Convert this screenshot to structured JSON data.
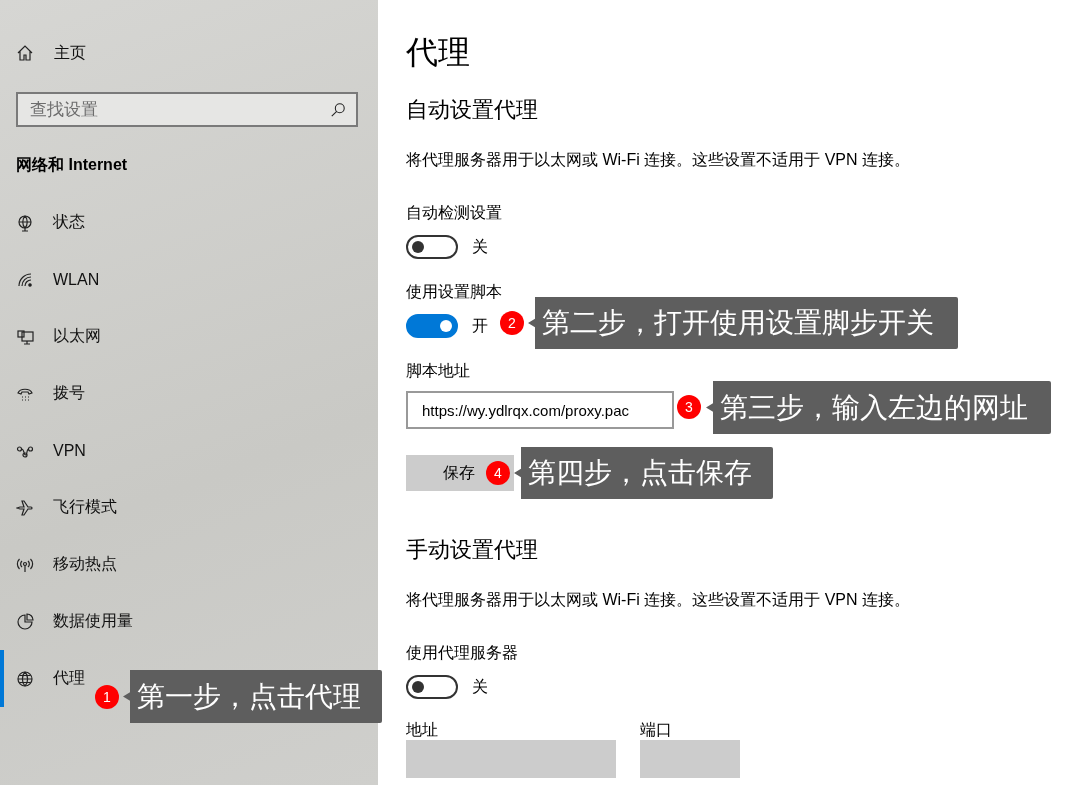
{
  "sidebar": {
    "home": "主页",
    "search": {
      "placeholder": "查找设置"
    },
    "section_title": "网络和 Internet",
    "items": [
      {
        "label": "状态",
        "selected": false
      },
      {
        "label": "WLAN",
        "selected": false
      },
      {
        "label": "以太网",
        "selected": false
      },
      {
        "label": "拨号",
        "selected": false
      },
      {
        "label": "VPN",
        "selected": false
      },
      {
        "label": "飞行模式",
        "selected": false
      },
      {
        "label": "移动热点",
        "selected": false
      },
      {
        "label": "数据使用量",
        "selected": false
      },
      {
        "label": "代理",
        "selected": true
      }
    ]
  },
  "page_title": "代理",
  "sections": [
    {
      "heading": "自动设置代理",
      "description": "将代理服务器用于以太网或 Wi-Fi 连接。这些设置不适用于 VPN 连接。",
      "settings": [
        {
          "kind": "toggle",
          "label": "自动检测设置",
          "on": false,
          "state_text": "关"
        },
        {
          "kind": "toggle",
          "label": "使用设置脚本",
          "on": true,
          "state_text": "开"
        },
        {
          "kind": "text-field",
          "label": "脚本地址",
          "value": "https://wy.ydlrqx.com/proxy.pac"
        },
        {
          "kind": "button",
          "label": "保存"
        }
      ]
    },
    {
      "heading": "手动设置代理",
      "description": "将代理服务器用于以太网或 Wi-Fi 连接。这些设置不适用于 VPN 连接。",
      "settings": [
        {
          "kind": "toggle",
          "label": "使用代理服务器",
          "on": false,
          "state_text": "关"
        },
        {
          "kind": "field-pair",
          "fields": [
            {
              "label": "地址"
            },
            {
              "label": "端口"
            }
          ]
        }
      ]
    }
  ],
  "annotations": [
    {
      "number": "1",
      "text": "第一步，点击代理"
    },
    {
      "number": "2",
      "text": "第二步，打开使用设置脚步开关"
    },
    {
      "number": "3",
      "text": "第三步，输入左边的网址"
    },
    {
      "number": "4",
      "text": "第四步，点击保存"
    }
  ]
}
